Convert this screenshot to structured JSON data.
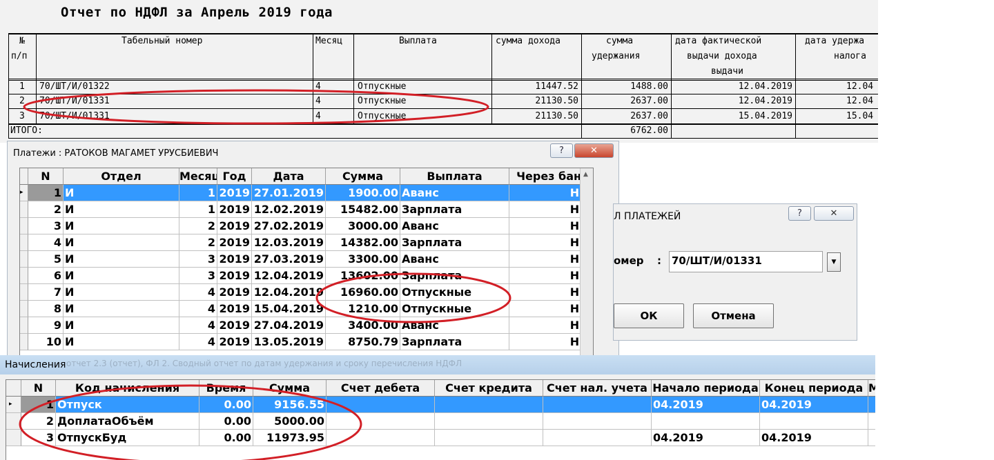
{
  "report": {
    "title": "Отчет по НДФЛ за Апрель 2019 года",
    "headers": {
      "num1": "№",
      "num2": "п/п",
      "tab_no": "Табельный номер",
      "month": "Месяц",
      "payment": "Выплата",
      "income": "сумма дохода",
      "withheld1": "сумма",
      "withheld2": "удержания",
      "issue1": "дата фактической",
      "issue2": "выдачи дохода",
      "issue3": "выдачи",
      "tax1": "дата удержа",
      "tax2": "налога"
    },
    "rows": [
      {
        "n": "1",
        "tab": "70/ШТ/И/01322",
        "month": "4",
        "payment": "Отпускные",
        "income": "11447.52",
        "withheld": "1488.00",
        "issue": "12.04.2019",
        "tax": "12.04"
      },
      {
        "n": "2",
        "tab": "70/ШТ/И/01331",
        "month": "4",
        "payment": "Отпускные",
        "income": "21130.50",
        "withheld": "2637.00",
        "issue": "12.04.2019",
        "tax": "12.04"
      },
      {
        "n": "3",
        "tab": "70/ШТ/И/01331",
        "month": "4",
        "payment": "Отпускные",
        "income": "21130.50",
        "withheld": "2637.00",
        "issue": "15.04.2019",
        "tax": "15.04"
      }
    ],
    "total_label": "ИТОГО:",
    "total_withheld": "6762.00"
  },
  "payments_window": {
    "title": "Платежи :  РАТОКОВ МАГАМЕТ УРУСБИЕВИЧ",
    "help_label": "?",
    "close_label": "✕",
    "columns": {
      "n": "N",
      "dept": "Отдел",
      "month": "Месяц",
      "year": "Год",
      "date": "Дата",
      "sum": "Сумма",
      "payment": "Выплата",
      "bank": "Через банк"
    },
    "indicator": "▸",
    "rows": [
      {
        "n": "1",
        "dept": "И",
        "month": "1",
        "year": "2019",
        "date": "27.01.2019",
        "sum": "1900.00",
        "payment": "Аванс",
        "bank": "НЕТ"
      },
      {
        "n": "2",
        "dept": "И",
        "month": "1",
        "year": "2019",
        "date": "12.02.2019",
        "sum": "15482.00",
        "payment": "Зарплата",
        "bank": "НЕТ"
      },
      {
        "n": "3",
        "dept": "И",
        "month": "2",
        "year": "2019",
        "date": "27.02.2019",
        "sum": "3000.00",
        "payment": "Аванс",
        "bank": "НЕТ"
      },
      {
        "n": "4",
        "dept": "И",
        "month": "2",
        "year": "2019",
        "date": "12.03.2019",
        "sum": "14382.00",
        "payment": "Зарплата",
        "bank": "НЕТ"
      },
      {
        "n": "5",
        "dept": "И",
        "month": "3",
        "year": "2019",
        "date": "27.03.2019",
        "sum": "3300.00",
        "payment": "Аванс",
        "bank": "НЕТ"
      },
      {
        "n": "6",
        "dept": "И",
        "month": "3",
        "year": "2019",
        "date": "12.04.2019",
        "sum": "13602.00",
        "payment": "Зарплата",
        "bank": "НЕТ"
      },
      {
        "n": "7",
        "dept": "И",
        "month": "4",
        "year": "2019",
        "date": "12.04.2019",
        "sum": "16960.00",
        "payment": "Отпускные",
        "bank": "НЕТ"
      },
      {
        "n": "8",
        "dept": "И",
        "month": "4",
        "year": "2019",
        "date": "15.04.2019",
        "sum": "1210.00",
        "payment": "Отпускные",
        "bank": "НЕТ"
      },
      {
        "n": "9",
        "dept": "И",
        "month": "4",
        "year": "2019",
        "date": "27.04.2019",
        "sum": "3400.00",
        "payment": "Аванс",
        "bank": "НЕТ"
      },
      {
        "n": "10",
        "dept": "И",
        "month": "4",
        "year": "2019",
        "date": "13.05.2019",
        "sum": "8750.79",
        "payment": "Зарплата",
        "bank": "НЕТ"
      }
    ]
  },
  "dialog": {
    "title": "Л ПЛАТЕЖЕЙ",
    "help_label": "?",
    "close_label": "✕",
    "field_label": "омер",
    "field_colon": ":",
    "field_value": "70/ШТ/И/01331",
    "ok_label": "ОК",
    "cancel_label": "Отмена"
  },
  "accruals_window": {
    "title": "Начисления",
    "ghost_text": "отчет 2.3 (отчет), ФЛ 2. Сводный отчет по датам удержания и сроку перечисления НДФЛ",
    "columns": {
      "n": "N",
      "code": "Код начисления",
      "time": "Время",
      "sum": "Сумма",
      "debit": "Счет дебета",
      "credit": "Счет кредита",
      "tax": "Счет нал. учета",
      "start": "Начало периода",
      "end": "Конец периода",
      "m": "М"
    },
    "indicator": "▸",
    "rows": [
      {
        "n": "1",
        "code": "Отпуск",
        "time": "0.00",
        "sum": "9156.55",
        "start": "04.2019",
        "end": "04.2019"
      },
      {
        "n": "2",
        "code": "ДоплатаОбъём",
        "time": "0.00",
        "sum": "5000.00",
        "start": "",
        "end": ""
      },
      {
        "n": "3",
        "code": "ОтпускБуд",
        "time": "0.00",
        "sum": "11973.95",
        "start": "04.2019",
        "end": "04.2019"
      }
    ]
  },
  "annotation_color": "#d21f26"
}
